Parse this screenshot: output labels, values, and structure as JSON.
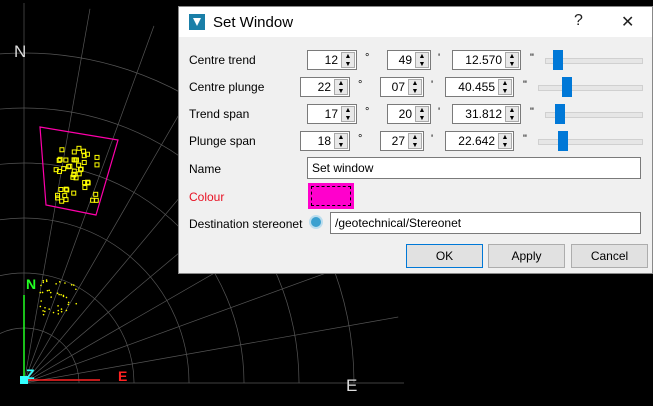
{
  "stereonet": {
    "north_label": "N",
    "east_label": "E",
    "axis_n": "N",
    "axis_z": "Z",
    "axis_e": "E",
    "window_color": "#ff00aa",
    "point_color": "#ffff00"
  },
  "dialog": {
    "title": "Set Window",
    "help": "?",
    "close": "✕",
    "rows": [
      {
        "label": "Centre trend",
        "deg": "12",
        "min": "49",
        "sec": "12.570",
        "slider": 0.08
      },
      {
        "label": "Centre plunge",
        "deg": "22",
        "min": "07",
        "sec": "40.455",
        "slider": 0.25
      },
      {
        "label": "Trend span",
        "deg": "17",
        "min": "20",
        "sec": "31.812",
        "slider": 0.1
      },
      {
        "label": "Plunge span",
        "deg": "18",
        "min": "27",
        "sec": "22.642",
        "slider": 0.2
      }
    ],
    "deg_unit": "°",
    "min_unit": "'",
    "sec_unit": "\"",
    "name_label": "Name",
    "name_value": "Set window",
    "colour_label": "Colour",
    "colour_value": "#ff00cc",
    "dest_label": "Destination stereonet",
    "dest_value": "/geotechnical/Stereonet",
    "ok": "OK",
    "apply": "Apply",
    "cancel": "Cancel"
  }
}
